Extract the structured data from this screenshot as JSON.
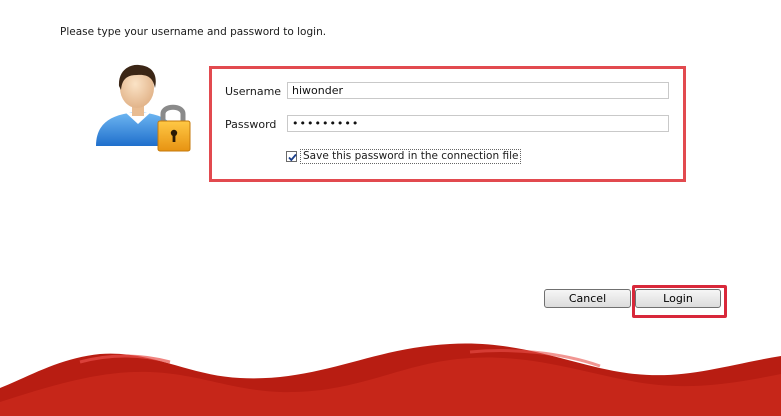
{
  "instruction": "Please type your username and password to login.",
  "form": {
    "username_label": "Username",
    "username_value": "hiwonder",
    "password_label": "Password",
    "password_value": "hiwonder9",
    "save_password_label": "Save this password in the connection file",
    "save_password_checked": true
  },
  "buttons": {
    "cancel_label": "Cancel",
    "login_label": "Login"
  },
  "icons": {
    "avatar": "user-with-padlock-icon",
    "check": "checkmark-icon"
  },
  "colors": {
    "highlight": "#e24a4f",
    "banner_red": "#c0261a",
    "banner_dark": "#a51a12",
    "padlock": "#f2a81d"
  }
}
